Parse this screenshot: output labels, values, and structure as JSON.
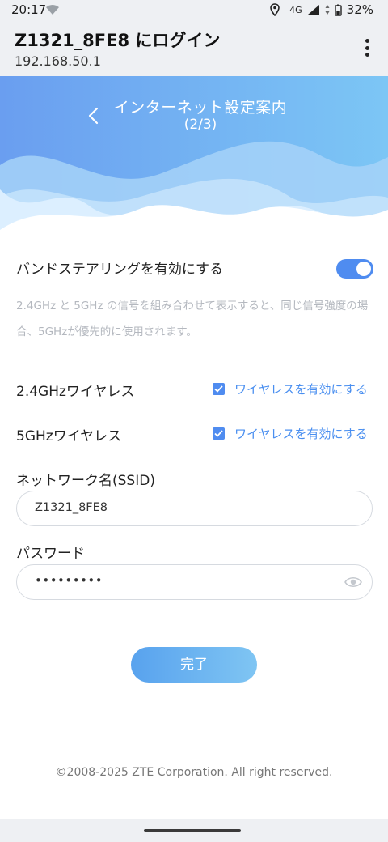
{
  "status_bar": {
    "time": "20:17",
    "network": "4G",
    "battery": "32%"
  },
  "header": {
    "title": "Z1321_8FE8 にログイン",
    "url": "192.168.50.1",
    "menu_icon": "more-vert-icon"
  },
  "hero": {
    "title": "インターネット設定案内",
    "step": "(2/3)",
    "back_icon": "chevron-left-icon",
    "colors": {
      "wave_light": "#b9defa",
      "wave_mid": "#8fc6f5",
      "top": "#6da7f0"
    }
  },
  "band_steering": {
    "label": "バンドステアリングを有効にする",
    "enabled": true,
    "hint": "2.4GHz と 5GHz の信号を組み合わせて表示すると、同じ信号強度の場合、5GHzが優先的に使用されます。"
  },
  "wireless": [
    {
      "label": "2.4GHzワイヤレス",
      "checkbox_label": "ワイヤレスを有効にする",
      "checked": true
    },
    {
      "label": "5GHzワイヤレス",
      "checkbox_label": "ワイヤレスを有効にする",
      "checked": true
    }
  ],
  "ssid": {
    "label": "ネットワーク名(SSID)",
    "value": "Z1321_8FE8"
  },
  "password": {
    "label": "パスワード",
    "masked_value": "•••••••••",
    "icon": "eye-icon"
  },
  "done_button": "完了",
  "footer": {
    "copyright": "©2008-2025 ZTE Corporation. All right reserved."
  },
  "accent_color": "#4f8cf0"
}
